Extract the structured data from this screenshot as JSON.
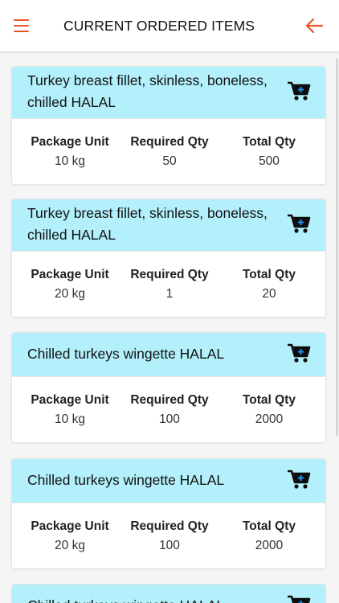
{
  "header": {
    "title": "CURRENT ORDERED ITEMS",
    "menu_icon": "hamburger-menu-icon",
    "back_icon": "arrow-left-icon",
    "accent_color": "#e8562a"
  },
  "labels": {
    "package_unit": "Package Unit",
    "required_qty": "Required Qty",
    "total_qty": "Total Qty"
  },
  "items": [
    {
      "name": "Turkey breast fillet, skinless, boneless, chilled HALAL",
      "package_unit": "10 kg",
      "required_qty": "50",
      "total_qty": "500"
    },
    {
      "name": "Turkey breast fillet, skinless, boneless, chilled HALAL",
      "package_unit": "20 kg",
      "required_qty": "1",
      "total_qty": "20"
    },
    {
      "name": "Chilled turkeys wingette HALAL",
      "package_unit": "10 kg",
      "required_qty": "100",
      "total_qty": "2000"
    },
    {
      "name": "Chilled turkeys wingette HALAL",
      "package_unit": "20 kg",
      "required_qty": "100",
      "total_qty": "2000"
    },
    {
      "name": "Chilled turkeys wingette HALAL",
      "package_unit": "",
      "required_qty": "",
      "total_qty": ""
    }
  ],
  "colors": {
    "card_header_bg": "#b3f0fb",
    "cart_icon": "#0d0d0d",
    "cart_plus": "#2196f3"
  }
}
